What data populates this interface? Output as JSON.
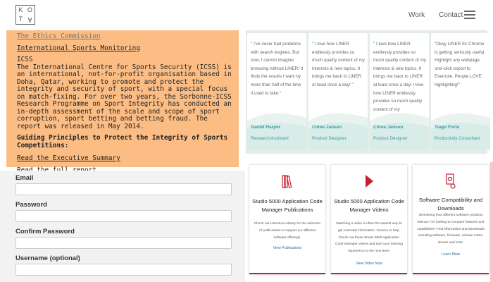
{
  "header": {
    "logo_letters": [
      "K",
      "O",
      "T",
      "A"
    ],
    "nav_work": "Work",
    "nav_contact": "Contact"
  },
  "orange_panel": {
    "link_ethics": "The Ethics Commission",
    "link_monitoring": "International Sports Monitoring",
    "icss_heading": "ICSS",
    "icss_para": "The International Centre for Sports Security (ICSS) is an international, not-for-profit organisation based in Doha, Qatar, working to promote and protect the integrity and security of sport, with a special focus on match-fixing. For over two years, the Sorbonne-ICSS Research Programme on Sport Integrity has conducted an in-depth assessment of the scale and scope of sport corruption, sport betting and betting fraud. The report was released in May 2014.",
    "guiding": "Guiding Principles to Protect the Integrity of Sports Competitions:",
    "link_summary": "Read the Executive Summary",
    "link_report": "Read the full report"
  },
  "form": {
    "email_label": "Email",
    "password_label": "Password",
    "confirm_label": "Confirm Password",
    "username_label": "Username (optional)"
  },
  "testimonials": [
    {
      "quote": "\" I've never had problems with search engines. But now, I cannot imagine browsing without LINER! It finds the results I want by more than half of the time it used to take.\"",
      "name": "Daniel Harper",
      "role": "Research Assistant"
    },
    {
      "quote": "\" I love how LINER endlessly provides so much quality content of my interests & new topics. It brings me back to LINER at least once a day! \"",
      "name": "Chloe Jansen",
      "role": "Product Designer"
    },
    {
      "quote": "\" I love how LINER endlessly provides so much quality content of my interests & new topics. It brings me back to LINER at least once a day! I love how LINER endlessly provides so much quality content of my",
      "name": "Chloe Jansen",
      "role": "Product Designer"
    },
    {
      "quote": "\"Okay LINER for Chrome is getting seriously useful. Highlight any webpage, one-click export to Evernote. People LOVE highlighting!\"",
      "name": "Tiago Forte",
      "role": "Productivity Consultant"
    }
  ],
  "products": [
    {
      "icon": "books-icon",
      "title": "Studio 5000 Application Code Manager Publications",
      "desc": "Check out Literature Library for the selection of publications to support our different software offerings.",
      "link": "View Publications"
    },
    {
      "icon": "play-icon",
      "title": "Studio 5000 Application Code Manager Videos",
      "desc": "Watching a video is often the easiest way to get essential information. Cinema to help. Check out these Studio 5000 Application Code Manager videos and start your learning experience to the next level.",
      "link": "View Video Now"
    },
    {
      "icon": "software-compatibility-icon",
      "title": "Software Compatibility and Downloads",
      "desc": "Wondering how different software products interact? Or looking to compare features and capabilities? Find information and downloads including software, firmware, release notes, drivers and tools.",
      "link": "Learn More"
    }
  ],
  "colors": {
    "accent_red": "#c62030",
    "teal": "#3a9aa8",
    "orange_panel": "#fbbd84"
  }
}
